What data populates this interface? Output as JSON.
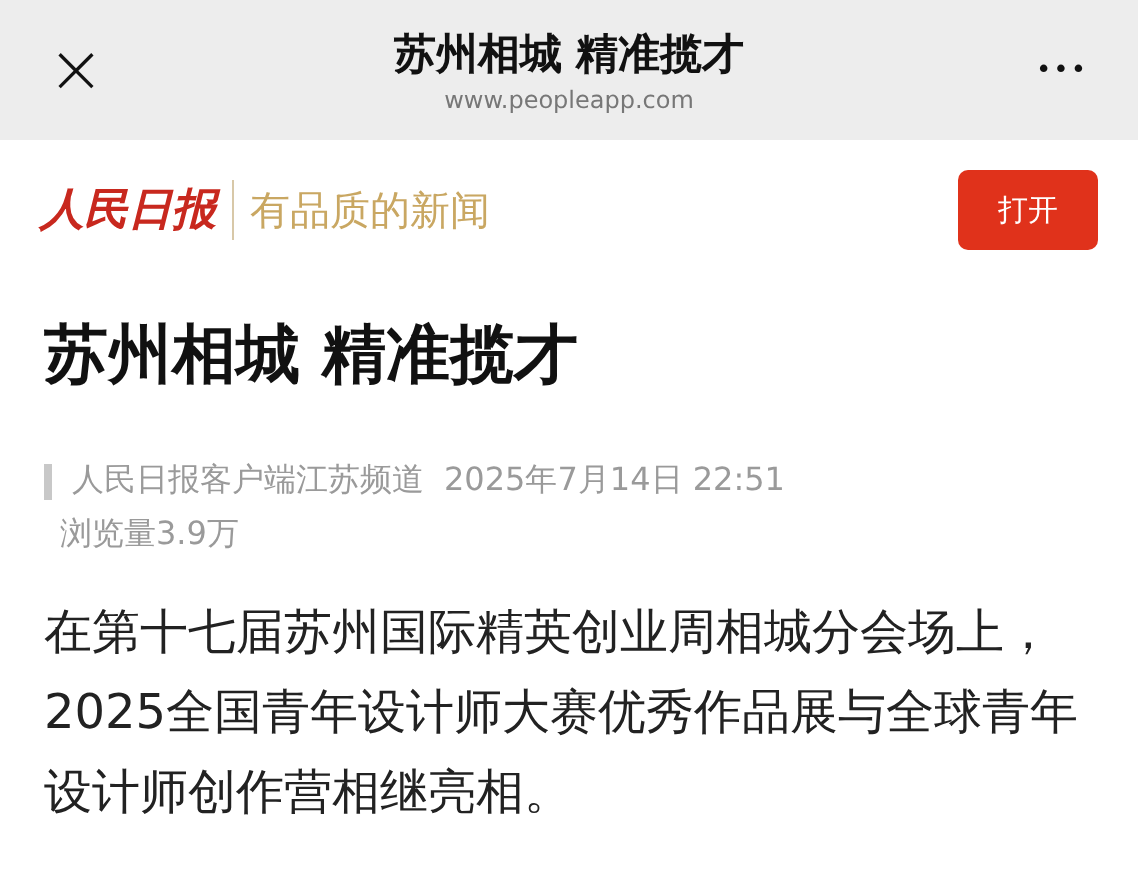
{
  "header": {
    "close": "×",
    "title": "苏州相城 精准揽才",
    "url": "www.peopleapp.com",
    "more": "•••"
  },
  "banner": {
    "logo": "人民日报",
    "slogan": "有品质的新闻",
    "button": "打开"
  },
  "article": {
    "headline": "苏州相城 精准揽才",
    "source": "人民日报客户端江苏频道",
    "date": "2025年7月14日 22:51",
    "views": "浏览量3.9万",
    "body": "在第十七届苏州国际精英创业周相城分会场上，2025全国青年设计师大赛优秀作品展与全球青年设计师创作营相继亮相。"
  }
}
